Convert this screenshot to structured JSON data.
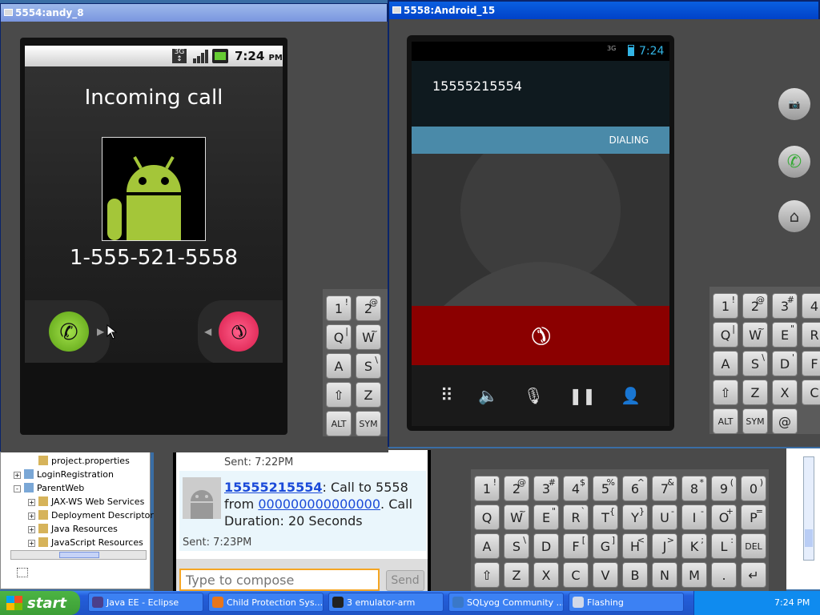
{
  "colors": {
    "desktop": "#3a6ea5",
    "taskbar": "#245edb",
    "start": "#3c9e36",
    "dialing_bar": "#4a8aa9",
    "end_call": "#8b0000",
    "answer": "#6fbf1e",
    "reject": "#e0255a"
  },
  "window_andy": {
    "title": "5554:andy_8",
    "status_time": "7:24",
    "status_ampm": "PM",
    "heading": "Incoming call",
    "number": "1-555-521-5558"
  },
  "window_android15": {
    "title": "5558:Android_15",
    "status_time": "7:24",
    "number": "15555215554",
    "dialing_label": "DIALING"
  },
  "kbd_small_left": {
    "rows": [
      [
        "1",
        "!",
        "2",
        "@"
      ],
      [
        "Q",
        "|",
        "W",
        "~"
      ],
      [
        "A",
        "",
        "S",
        "\\"
      ],
      [
        "⇧",
        "",
        "Z",
        ""
      ],
      [
        "ALT",
        "",
        "SYM",
        ""
      ]
    ]
  },
  "kbd_small_right": {
    "rows": [
      [
        "1",
        "!",
        "2",
        "@",
        "3",
        "#",
        "4",
        ""
      ],
      [
        "Q",
        "|",
        "W",
        "~",
        "E",
        "\"",
        "R",
        ""
      ],
      [
        "A",
        "",
        "S",
        "\\",
        "D",
        "'",
        "F",
        ""
      ],
      [
        "⇧",
        "",
        "Z",
        "",
        "X",
        "",
        "C",
        ""
      ],
      [
        "ALT",
        "",
        "SYM",
        "",
        "@",
        "",
        "",
        ""
      ]
    ]
  },
  "kbd_big": {
    "rows": [
      [
        "1",
        "!",
        "2",
        "@",
        "3",
        "#",
        "4",
        "$",
        "5",
        "%",
        "6",
        "^",
        "7",
        "&",
        "8",
        "*",
        "9",
        "(",
        "0",
        ")"
      ],
      [
        "Q",
        "",
        "W",
        "~",
        "E",
        "\"",
        "R",
        "`",
        "T",
        "{",
        "Y",
        "}",
        "U",
        "-",
        "I",
        "-",
        "O",
        "+",
        "P",
        "="
      ],
      [
        "A",
        "",
        "S",
        "\\",
        "D",
        "",
        "F",
        "[",
        "G",
        "]",
        "H",
        "<",
        "J",
        ">",
        "K",
        ";",
        "L",
        ":",
        "DEL",
        ""
      ],
      [
        "⇧",
        "",
        "Z",
        "",
        "X",
        "",
        "C",
        "",
        "V",
        "",
        "B",
        "",
        "N",
        "",
        "M",
        "",
        ".",
        "",
        "↵",
        ""
      ]
    ]
  },
  "sms": {
    "prev_sent": "Sent: 7:22PM",
    "sender_link": "15555215554",
    "msg_a": ": Call to 5558",
    "msg_from": "from ",
    "from_link": "000000000000000",
    "msg_b": ". Call",
    "msg_c": "Duration: 20 Seconds",
    "sent": "Sent: 7:23PM",
    "compose_placeholder": "Type to compose",
    "send_label": "Send"
  },
  "eclipse_tree": {
    "items": [
      {
        "label": "project.properties",
        "indent": 1,
        "pm": ""
      },
      {
        "label": "LoginRegistration",
        "indent": 0,
        "pm": "+"
      },
      {
        "label": "ParentWeb",
        "indent": 0,
        "pm": "-"
      },
      {
        "label": "JAX-WS Web Services",
        "indent": 1,
        "pm": "+"
      },
      {
        "label": "Deployment Descriptor:",
        "indent": 1,
        "pm": "+"
      },
      {
        "label": "Java Resources",
        "indent": 1,
        "pm": "+"
      },
      {
        "label": "JavaScript Resources",
        "indent": 1,
        "pm": "+"
      }
    ]
  },
  "taskbar": {
    "start_label": "start",
    "buttons": [
      {
        "label": "Java EE - Eclipse",
        "icon_color": "#4b3f8c"
      },
      {
        "label": "Child Protection Sys...",
        "icon_color": "#e8761c"
      },
      {
        "label": "3 emulator-arm",
        "icon_color": "#222"
      },
      {
        "label": "SQLyog Community ...",
        "icon_color": "#3a78c8"
      },
      {
        "label": "Flashing",
        "icon_color": "#d0d8e8"
      }
    ],
    "clock": "7:24 PM"
  }
}
